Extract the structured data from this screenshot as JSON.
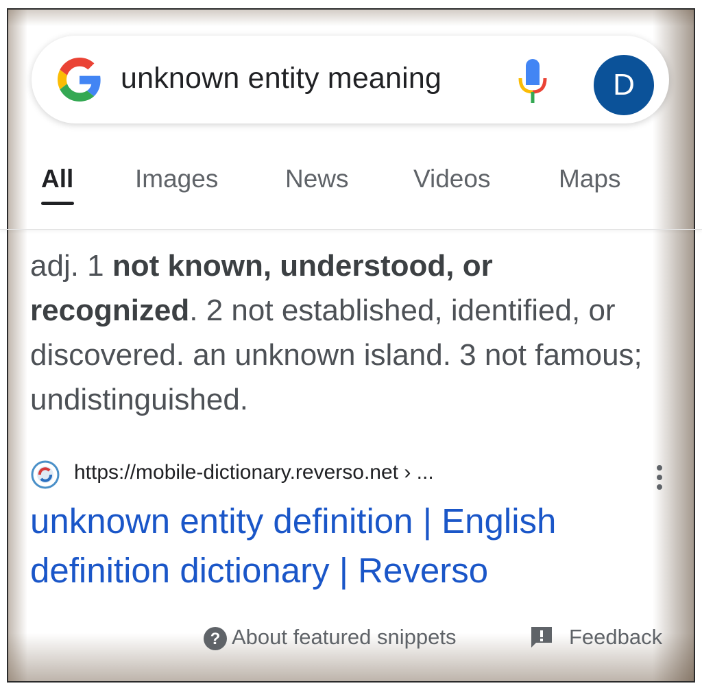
{
  "search": {
    "query": "unknown entity meaning",
    "avatar_letter": "D"
  },
  "tabs": [
    {
      "label": "All",
      "active": true
    },
    {
      "label": "Images",
      "active": false
    },
    {
      "label": "News",
      "active": false
    },
    {
      "label": "Videos",
      "active": false
    },
    {
      "label": "Maps",
      "active": false
    }
  ],
  "definition": {
    "part1": "adj. 1 ",
    "bold1": "not known, understood, or recognized",
    "part2": ". 2 not established, identified, or discovered. an unknown island. 3 not famous; undistinguished."
  },
  "result": {
    "url": "https://mobile-dictionary.reverso.net › ...",
    "title": "unknown entity definition | English definition dictionary | Reverso"
  },
  "footer": {
    "about": "About featured snippets",
    "feedback": "Feedback"
  },
  "colors": {
    "link": "#1a56c8",
    "avatar_bg": "#0b5299",
    "google_blue": "#4285F4",
    "google_red": "#EA4335",
    "google_yellow": "#FBBC05",
    "google_green": "#34A853"
  },
  "icons": {
    "logo": "google-g-icon",
    "mic": "microphone-icon",
    "favicon": "reverso-favicon-icon",
    "more": "more-vert-icon",
    "about": "help-circle-icon",
    "feedback": "feedback-icon"
  }
}
